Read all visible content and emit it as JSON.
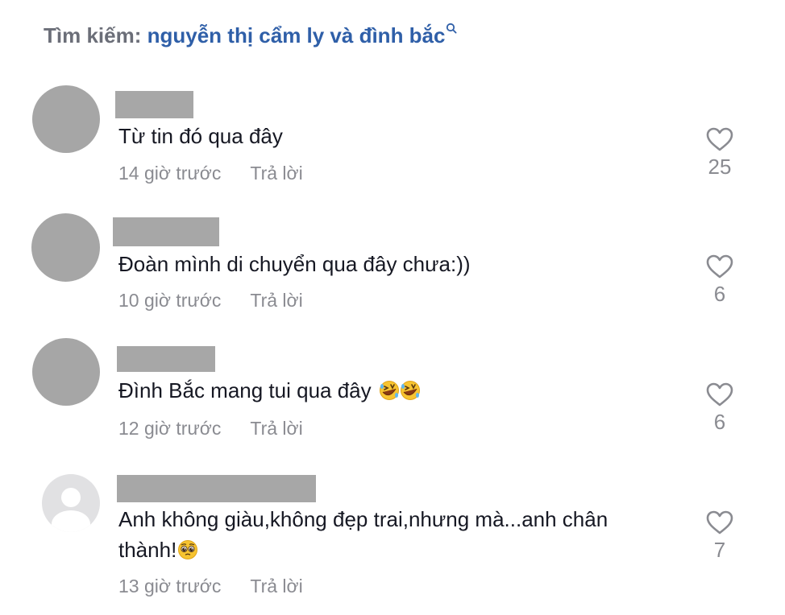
{
  "search": {
    "label": "Tìm kiếm:",
    "query": "nguyễn thị cẩm ly và đình bắc",
    "icon": "search-icon"
  },
  "comments": [
    {
      "text": "Từ tin đó qua đây",
      "time": "14 giờ trước",
      "reply": "Trả lời",
      "likes": "25",
      "avatar": "gray-circle"
    },
    {
      "text": "Đoàn mình di chuyển qua đây chưa:))",
      "time": "10 giờ trước",
      "reply": "Trả lời",
      "likes": "6",
      "avatar": "gray-circle"
    },
    {
      "text": "Đình Bắc mang tui qua đây",
      "emojis": [
        "rofl-emoji",
        "rofl-emoji"
      ],
      "time": "12 giờ trước",
      "reply": "Trả lời",
      "likes": "6",
      "avatar": "gray-circle"
    },
    {
      "text_line1": "Anh không giàu,không đẹp trai,nhưng mà...anh chân",
      "text_line2": "thành!",
      "emojis": [
        "pleading-face-emoji"
      ],
      "time": "13 giờ trước",
      "reply": "Trả lời",
      "likes": "7",
      "avatar": "default-user-avatar"
    }
  ],
  "colors": {
    "query": "#2f5fa8",
    "label": "#6b6e78",
    "meta": "#8a8b91",
    "text": "#161823",
    "redact": "#a7a7a7"
  }
}
